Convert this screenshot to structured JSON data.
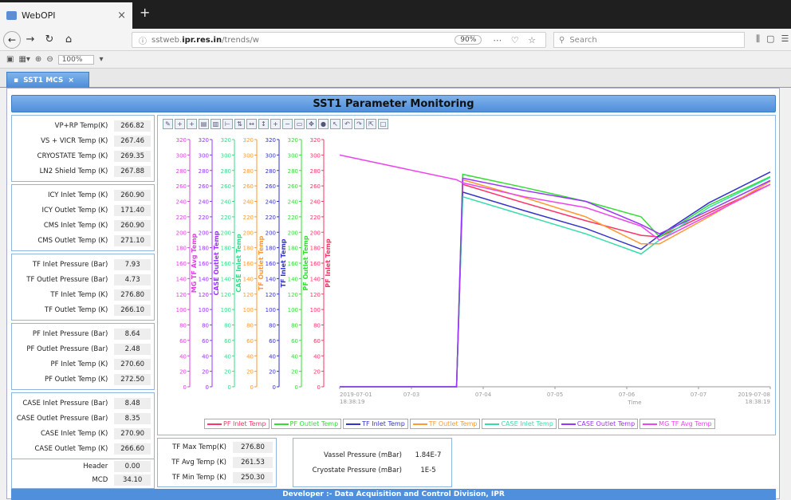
{
  "browser": {
    "tab_title": "WebOPI",
    "url_prefix": "sstweb.",
    "url_host": "ipr.res.in",
    "url_path": "/trends/w",
    "zoom": "90%",
    "search_placeholder": "Search",
    "opi_zoom": "100%"
  },
  "app": {
    "tab_label": "SST1 MCS",
    "title": "SST1 Parameter Monitoring",
    "footer": "Developer :- Data Acquisition and Control Division, IPR"
  },
  "groups": [
    {
      "items": [
        {
          "label": "VP+RP Temp(K)",
          "value": "266.82"
        },
        {
          "label": "VS + VICR Temp (K)",
          "value": "267.46"
        },
        {
          "label": "CRYOSTATE Temp (K)",
          "value": "269.35"
        },
        {
          "label": "LN2 Shield Temp (K)",
          "value": "267.88"
        }
      ]
    },
    {
      "items": [
        {
          "label": "ICY Inlet Temp (K)",
          "value": "260.90"
        },
        {
          "label": "ICY Outlet Temp (K)",
          "value": "171.40"
        },
        {
          "label": "CMS Inlet Temp (K)",
          "value": "260.90"
        },
        {
          "label": "CMS Outlet Temp (K)",
          "value": "271.10"
        }
      ]
    },
    {
      "items": [
        {
          "label": "TF Inlet Pressure (Bar)",
          "value": "7.93"
        },
        {
          "label": "TF Outlet Pressure (Bar)",
          "value": "4.73"
        },
        {
          "label": "TF Inlet Temp (K)",
          "value": "276.80"
        },
        {
          "label": "TF Outlet Temp (K)",
          "value": "266.10"
        }
      ]
    },
    {
      "items": [
        {
          "label": "PF Inlet Pressure (Bar)",
          "value": "8.64"
        },
        {
          "label": "PF Outlet Pressure (Bar)",
          "value": "2.48"
        },
        {
          "label": "PF Inlet Temp (K)",
          "value": "270.60"
        },
        {
          "label": "PF Outlet Temp (K)",
          "value": "272.50"
        }
      ]
    },
    {
      "items": [
        {
          "label": "CASE Inlet Pressure (Bar)",
          "value": "8.48"
        },
        {
          "label": "CASE Outlet Pressure (Bar)",
          "value": "8.35"
        },
        {
          "label": "CASE Inlet Temp (K)",
          "value": "270.90"
        },
        {
          "label": "CASE Outlet Temp (K)",
          "value": "266.60"
        }
      ]
    },
    {
      "items": [
        {
          "label": "Header",
          "value": "0.00"
        },
        {
          "label": "MCD",
          "value": "34.10"
        }
      ]
    }
  ],
  "tf_summary": [
    {
      "label": "TF Max Temp(K)",
      "value": "276.80"
    },
    {
      "label": "TF Avg Temp (K)",
      "value": "261.53"
    },
    {
      "label": "TF Min Temp (K)",
      "value": "250.30"
    }
  ],
  "pressure_summary": [
    {
      "label": "Vassel Pressure (mBar)",
      "value": "1.84E-7"
    },
    {
      "label": "Cryostate Pressure (mBar)",
      "value": "1E-5"
    }
  ],
  "chart_data": {
    "type": "line",
    "xlabel": "Time",
    "x_ticks": [
      "2019-07-01\n18:38:19",
      "07-03",
      "07-04",
      "07-05",
      "07-06",
      "07-07",
      "2019-07-08\n18:38:19"
    ],
    "ylim": [
      0,
      320
    ],
    "y_ticks": [
      0,
      20,
      40,
      60,
      80,
      100,
      120,
      140,
      160,
      180,
      200,
      220,
      240,
      260,
      280,
      300,
      320
    ],
    "grid": false,
    "legend_position": "bottom",
    "y_axes": [
      {
        "label": "MG TF Avg Temp",
        "color": "#e040e0"
      },
      {
        "label": "CASE Outlet Temp",
        "color": "#9933ff"
      },
      {
        "label": "CASE Inlet Temp",
        "color": "#33dd88"
      },
      {
        "label": "TF Outlet Temp",
        "color": "#ff9933"
      },
      {
        "label": "TF Inlet Temp",
        "color": "#3333cc"
      },
      {
        "label": "PF Outlet Temp",
        "color": "#33dd33"
      },
      {
        "label": "PF Inlet Temp",
        "color": "#ff3366"
      }
    ],
    "x": [
      0,
      1.9,
      2.0,
      3.0,
      4.0,
      4.9,
      5.2,
      6.0,
      7.0
    ],
    "series": [
      {
        "name": "PF Inlet Temp",
        "color": "#ff3366",
        "values": [
          0,
          0,
          262,
          238,
          215,
          196,
          194,
          225,
          262
        ]
      },
      {
        "name": "PF Outlet Temp",
        "color": "#33dd33",
        "values": [
          0,
          0,
          275,
          258,
          240,
          220,
          194,
          235,
          272
        ]
      },
      {
        "name": "TF Inlet Temp",
        "color": "#3333cc",
        "values": [
          0,
          0,
          252,
          228,
          205,
          178,
          196,
          238,
          278
        ]
      },
      {
        "name": "TF Outlet Temp",
        "color": "#ff9933",
        "values": [
          0,
          0,
          268,
          245,
          220,
          185,
          185,
          220,
          266
        ]
      },
      {
        "name": "CASE Inlet Temp",
        "color": "#33ddaa",
        "values": [
          0,
          0,
          246,
          222,
          198,
          172,
          190,
          232,
          271
        ]
      },
      {
        "name": "CASE Outlet Temp",
        "color": "#9933ff",
        "values": [
          0,
          0,
          270,
          254,
          240,
          210,
          198,
          228,
          267
        ]
      },
      {
        "name": "MG TF Avg Temp",
        "color": "#ee44ee",
        "values": [
          300,
          268,
          264,
          246,
          232,
          208,
          190,
          222,
          262
        ]
      }
    ]
  }
}
